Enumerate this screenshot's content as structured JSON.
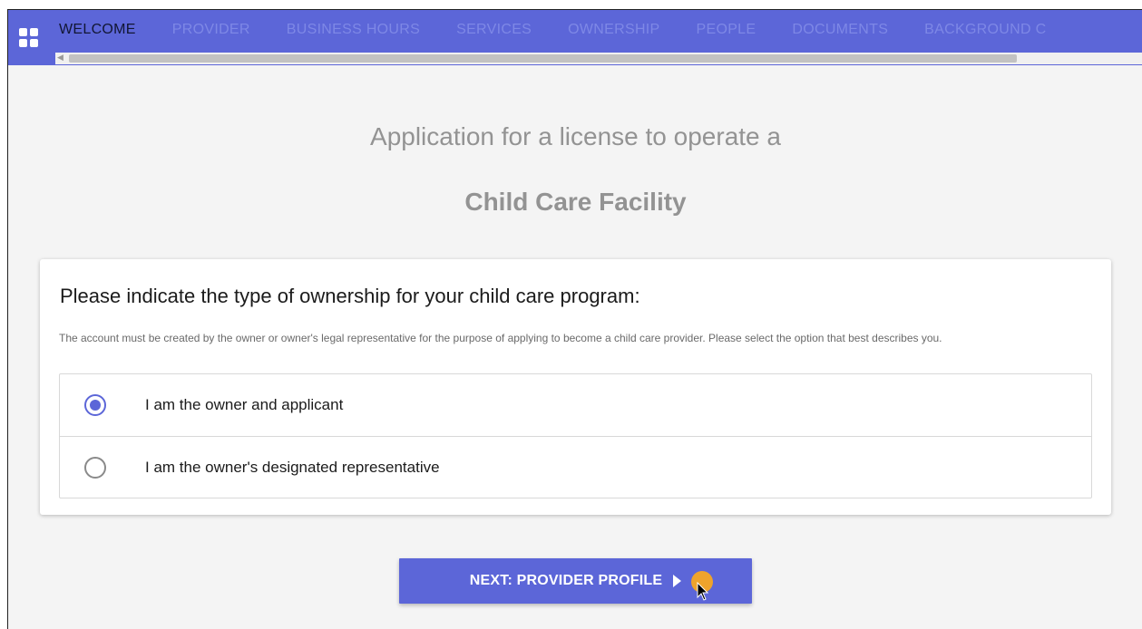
{
  "nav": {
    "tabs": [
      {
        "label": "WELCOME",
        "active": true
      },
      {
        "label": "PROVIDER",
        "active": false
      },
      {
        "label": "BUSINESS HOURS",
        "active": false
      },
      {
        "label": "SERVICES",
        "active": false
      },
      {
        "label": "OWNERSHIP",
        "active": false
      },
      {
        "label": "PEOPLE",
        "active": false
      },
      {
        "label": "DOCUMENTS",
        "active": false
      },
      {
        "label": "BACKGROUND C",
        "active": false
      }
    ],
    "apps_icon": "apps-grid-icon"
  },
  "header": {
    "title_line1": "Application for a license to operate a",
    "title_line2": "Child Care Facility"
  },
  "ownership_card": {
    "heading": "Please indicate the type of ownership for your child care program:",
    "description": "The account must be created by the owner or owner's legal representative for the purpose of applying to become a child care provider. Please select the option that best describes you.",
    "options": [
      {
        "label": "I am the owner and applicant",
        "selected": true
      },
      {
        "label": "I am the owner's designated representative",
        "selected": false
      }
    ]
  },
  "actions": {
    "next_label": "NEXT: PROVIDER PROFILE",
    "next_icon": "play-arrow-icon"
  },
  "colors": {
    "primary": "#5c66d8",
    "tab_inactive": "#7e88e6",
    "tab_active": "#111633",
    "title_gray": "#939393",
    "cursor_highlight": "#f5a623"
  }
}
